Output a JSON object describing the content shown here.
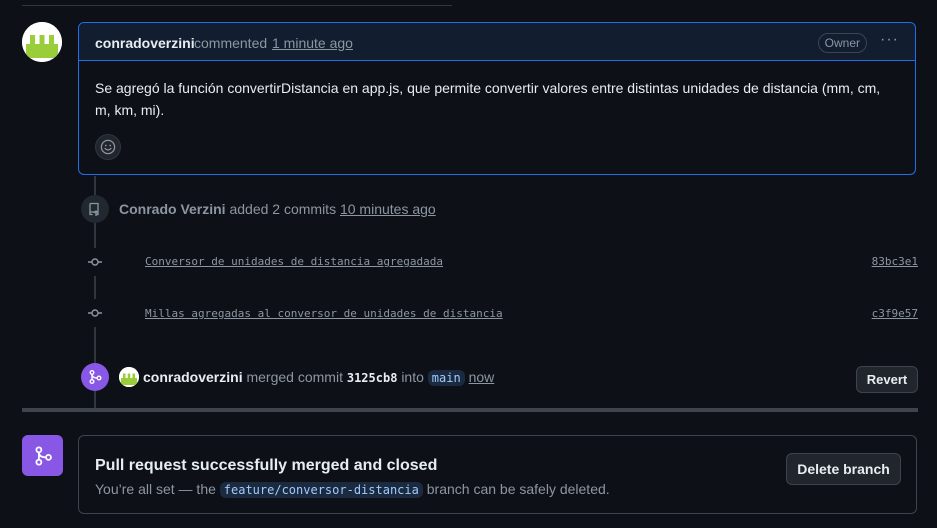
{
  "comment": {
    "author": "conradoverzini",
    "verb": "commented",
    "time": "1 minute ago",
    "badge": "Owner",
    "menu_glyph": "···",
    "body": "Se agregó la función convertirDistancia en app.js, que permite convertir valores entre distintas unidades de distancia (mm, cm, m, km, mi)."
  },
  "commits_event": {
    "actor": "Conrado Verzini",
    "action": "added 2 commits",
    "time": "10 minutes ago"
  },
  "commits": [
    {
      "message": "Conversor de unidades de distancia agregadada",
      "sha": "83bc3e1"
    },
    {
      "message": "Millas agregadas al conversor de unidades de distancia",
      "sha": "c3f9e57"
    }
  ],
  "merge_event": {
    "actor": "conradoverzini",
    "verb": "merged commit",
    "sha": "3125cb8",
    "into": "into",
    "branch": "main",
    "time": "now",
    "revert_label": "Revert"
  },
  "status": {
    "title": "Pull request successfully merged and closed",
    "desc_prefix": "You’re all set — the",
    "branch": "feature/conversor-distancia",
    "desc_suffix": "branch can be safely deleted.",
    "delete_label": "Delete branch"
  },
  "colors": {
    "accent_blue": "#1f6feb",
    "merged_purple": "#8957e5",
    "avatar_green": "#9acd3a"
  }
}
